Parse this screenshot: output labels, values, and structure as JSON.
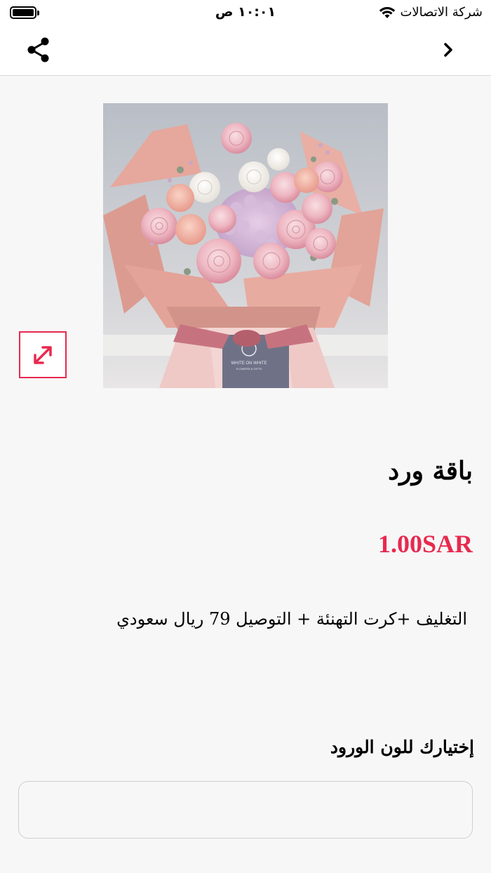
{
  "status_bar": {
    "carrier": "شركة الاتصالات",
    "time": "١٠:٠١ ص",
    "battery_level": 1.0
  },
  "nav": {
    "share_icon": "share-icon",
    "back_icon": "chevron-right-icon"
  },
  "product": {
    "image_label": "WHITE ON WHITE",
    "image_sublabel": "FLOWERS & GIFTS",
    "title": "باقة ورد",
    "price": "1.00SAR",
    "description": "التغليف +كرت التهنئة + التوصيل 79 ريال سعودي",
    "expand_icon": "expand-icon"
  },
  "options": {
    "color_label": "إختيارك للون الورود",
    "color_value": "",
    "color_placeholder": ""
  },
  "colors": {
    "accent": "#e8294f",
    "background": "#f7f7f7"
  }
}
